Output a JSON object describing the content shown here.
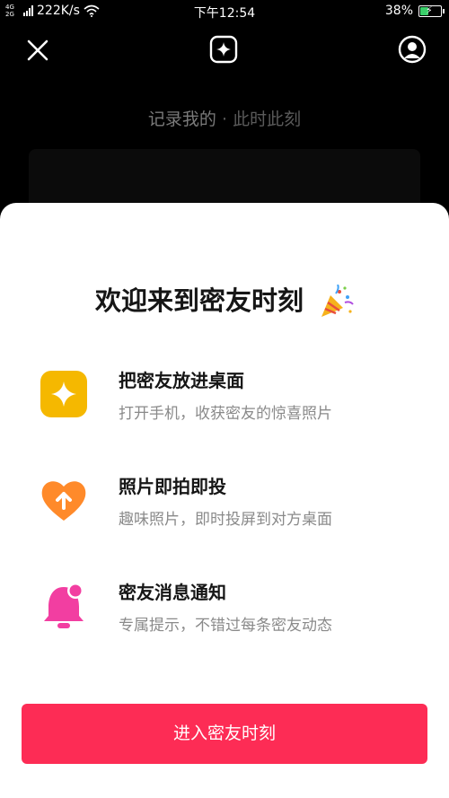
{
  "status_bar": {
    "network_type": "4G 2G",
    "speed": "222K/s",
    "time": "下午12:54",
    "battery_percent": "38%",
    "battery_level": 0.38,
    "battery_color": "#3ad06a"
  },
  "top_nav": {
    "icons": [
      "close-icon",
      "sparkle-icon",
      "profile-icon"
    ]
  },
  "background": {
    "caption_main": "记录我的",
    "caption_sub": "· 此时此刻"
  },
  "sheet": {
    "title": "欢迎来到密友时刻",
    "title_emoji_icon": "party-popper-icon",
    "features": [
      {
        "icon": "sparkle-tile-icon",
        "icon_color": "#f5b800",
        "title": "把密友放进桌面",
        "description": "打开手机，收获密友的惊喜照片"
      },
      {
        "icon": "heart-arrow-icon",
        "icon_color": "#ff8a2a",
        "title": "照片即拍即投",
        "description": "趣味照片，即时投屏到对方桌面"
      },
      {
        "icon": "bell-icon",
        "icon_color": "#f23ea1",
        "title": "密友消息通知",
        "description": "专属提示，不错过每条密友动态"
      }
    ],
    "enter_button_label": "进入密友时刻",
    "accent_color": "#fd2c55"
  }
}
